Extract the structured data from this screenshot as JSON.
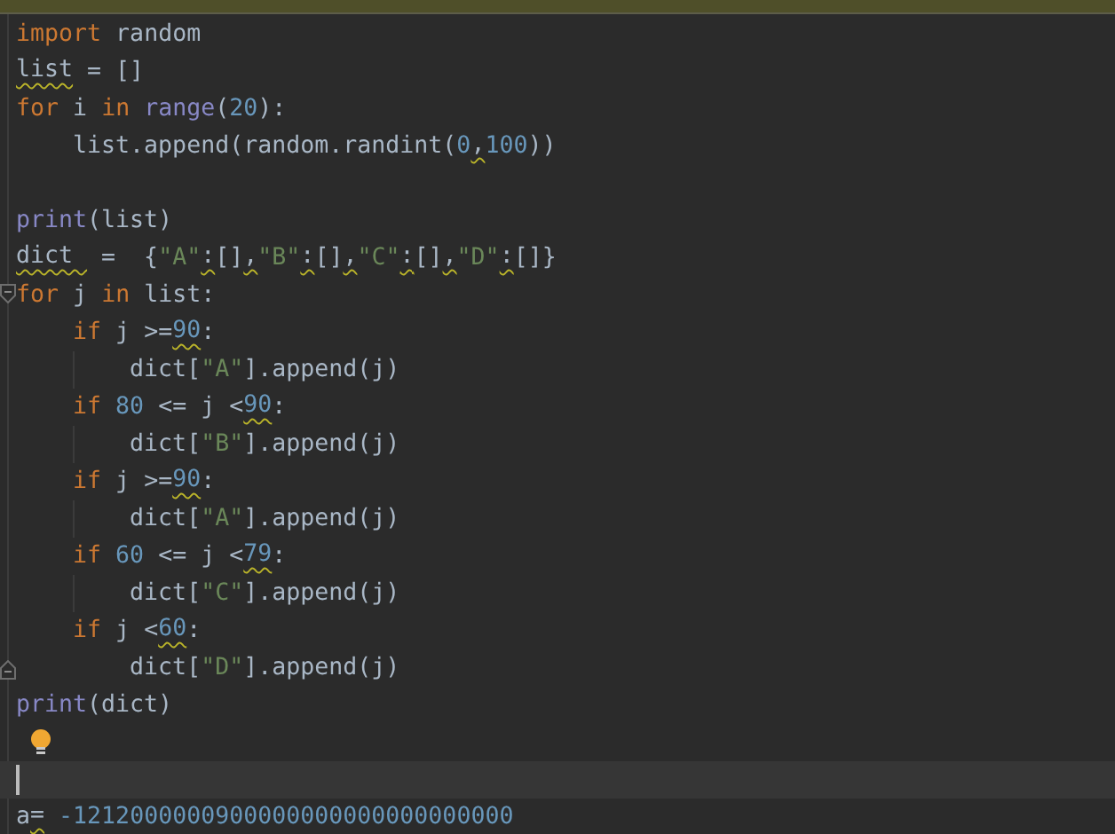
{
  "editor": {
    "lines": [
      {
        "kind": "plain",
        "current": false,
        "bulb": false,
        "tokens": [
          {
            "text": "import",
            "kind": "keyword",
            "warning": false
          },
          {
            "text": " random",
            "kind": "plain",
            "warning": false
          }
        ]
      },
      {
        "kind": "plain",
        "current": false,
        "bulb": false,
        "tokens": [
          {
            "text": "list",
            "kind": "plain",
            "warning": true
          },
          {
            "text": " = []",
            "kind": "plain",
            "warning": false
          }
        ]
      },
      {
        "kind": "plain",
        "current": false,
        "bulb": false,
        "tokens": [
          {
            "text": "for",
            "kind": "keyword",
            "warning": false
          },
          {
            "text": " i ",
            "kind": "plain",
            "warning": false
          },
          {
            "text": "in",
            "kind": "keyword",
            "warning": false
          },
          {
            "text": " range",
            "kind": "builtin",
            "warning": false
          },
          {
            "text": "(",
            "kind": "plain",
            "warning": false
          },
          {
            "text": "20",
            "kind": "number",
            "warning": false
          },
          {
            "text": "):",
            "kind": "plain",
            "warning": false
          }
        ]
      },
      {
        "kind": "plain",
        "current": false,
        "bulb": false,
        "tokens": [
          {
            "text": "    list.append(random.randint(",
            "kind": "plain",
            "warning": false
          },
          {
            "text": "0",
            "kind": "number",
            "warning": false
          },
          {
            "text": ",",
            "kind": "plain",
            "warning": true
          },
          {
            "text": "100",
            "kind": "number",
            "warning": false
          },
          {
            "text": "))",
            "kind": "plain",
            "warning": false
          }
        ]
      },
      {
        "kind": "plain",
        "current": false,
        "bulb": false
      },
      {
        "kind": "plain",
        "current": false,
        "bulb": false,
        "tokens": [
          {
            "text": "print",
            "kind": "builtin",
            "warning": false
          },
          {
            "text": "(list)",
            "kind": "plain",
            "warning": false
          }
        ]
      },
      {
        "kind": "plain",
        "current": false,
        "bulb": false,
        "tokens": [
          {
            "text": "dict ",
            "kind": "plain",
            "warning": true
          },
          {
            "text": " =  {",
            "kind": "plain",
            "warning": false
          },
          {
            "text": "\"A\"",
            "kind": "string",
            "warning": false
          },
          {
            "text": ":",
            "kind": "plain",
            "warning": true
          },
          {
            "text": "[]",
            "kind": "plain",
            "warning": false
          },
          {
            "text": ",",
            "kind": "plain",
            "warning": true
          },
          {
            "text": "\"B\"",
            "kind": "string",
            "warning": false
          },
          {
            "text": ":",
            "kind": "plain",
            "warning": true
          },
          {
            "text": "[]",
            "kind": "plain",
            "warning": false
          },
          {
            "text": ",",
            "kind": "plain",
            "warning": true
          },
          {
            "text": "\"C\"",
            "kind": "string",
            "warning": false
          },
          {
            "text": ":",
            "kind": "plain",
            "warning": true
          },
          {
            "text": "[]",
            "kind": "plain",
            "warning": false
          },
          {
            "text": ",",
            "kind": "plain",
            "warning": true
          },
          {
            "text": "\"D\"",
            "kind": "string",
            "warning": false
          },
          {
            "text": ":",
            "kind": "plain",
            "warning": true
          },
          {
            "text": "[]}",
            "kind": "plain",
            "warning": false
          }
        ]
      },
      {
        "kind": "opening",
        "current": false,
        "bulb": false,
        "tokens": [
          {
            "text": "for",
            "kind": "keyword",
            "warning": false
          },
          {
            "text": " j ",
            "kind": "plain",
            "warning": false
          },
          {
            "text": "in",
            "kind": "keyword",
            "warning": false
          },
          {
            "text": " list:",
            "kind": "plain",
            "warning": false
          }
        ]
      },
      {
        "kind": "plain",
        "current": false,
        "bulb": false,
        "tokens": [
          {
            "text": "    if",
            "kind": "keyword",
            "warning": false
          },
          {
            "text": " j >=",
            "kind": "plain",
            "warning": false
          },
          {
            "text": "90",
            "kind": "number",
            "warning": true
          },
          {
            "text": ":",
            "kind": "plain",
            "warning": false
          }
        ]
      },
      {
        "kind": "guided",
        "current": false,
        "bulb": false,
        "tokens": [
          {
            "text": "        dict[",
            "kind": "plain",
            "warning": false
          },
          {
            "text": "\"A\"",
            "kind": "string",
            "warning": false
          },
          {
            "text": "].append(j)",
            "kind": "plain",
            "warning": false
          }
        ]
      },
      {
        "kind": "plain",
        "current": false,
        "bulb": false,
        "tokens": [
          {
            "text": "    if",
            "kind": "keyword",
            "warning": false
          },
          {
            "text": " 80",
            "kind": "number",
            "warning": false
          },
          {
            "text": " <= j <",
            "kind": "plain",
            "warning": false
          },
          {
            "text": "90",
            "kind": "number",
            "warning": true
          },
          {
            "text": ":",
            "kind": "plain",
            "warning": false
          }
        ]
      },
      {
        "kind": "guided",
        "current": false,
        "bulb": false,
        "tokens": [
          {
            "text": "        dict[",
            "kind": "plain",
            "warning": false
          },
          {
            "text": "\"B\"",
            "kind": "string",
            "warning": false
          },
          {
            "text": "].append(j)",
            "kind": "plain",
            "warning": false
          }
        ]
      },
      {
        "kind": "plain",
        "current": false,
        "bulb": false,
        "tokens": [
          {
            "text": "    if",
            "kind": "keyword",
            "warning": false
          },
          {
            "text": " j >=",
            "kind": "plain",
            "warning": false
          },
          {
            "text": "90",
            "kind": "number",
            "warning": true
          },
          {
            "text": ":",
            "kind": "plain",
            "warning": false
          }
        ]
      },
      {
        "kind": "guided",
        "current": false,
        "bulb": false,
        "tokens": [
          {
            "text": "        dict[",
            "kind": "plain",
            "warning": false
          },
          {
            "text": "\"A\"",
            "kind": "string",
            "warning": false
          },
          {
            "text": "].append(j)",
            "kind": "plain",
            "warning": false
          }
        ]
      },
      {
        "kind": "plain",
        "current": false,
        "bulb": false,
        "tokens": [
          {
            "text": "    if",
            "kind": "keyword",
            "warning": false
          },
          {
            "text": " 60",
            "kind": "number",
            "warning": false
          },
          {
            "text": " <= j <",
            "kind": "plain",
            "warning": false
          },
          {
            "text": "79",
            "kind": "number",
            "warning": true
          },
          {
            "text": ":",
            "kind": "plain",
            "warning": false
          }
        ]
      },
      {
        "kind": "guided",
        "current": false,
        "bulb": false,
        "tokens": [
          {
            "text": "        dict[",
            "kind": "plain",
            "warning": false
          },
          {
            "text": "\"C\"",
            "kind": "string",
            "warning": false
          },
          {
            "text": "].append(j)",
            "kind": "plain",
            "warning": false
          }
        ]
      },
      {
        "kind": "plain",
        "current": false,
        "bulb": false,
        "tokens": [
          {
            "text": "    if",
            "kind": "keyword",
            "warning": false
          },
          {
            "text": " j <",
            "kind": "plain",
            "warning": false
          },
          {
            "text": "60",
            "kind": "number",
            "warning": true
          },
          {
            "text": ":",
            "kind": "plain",
            "warning": false
          }
        ]
      },
      {
        "kind": "closing",
        "current": false,
        "bulb": false,
        "tokens": [
          {
            "text": "        dict[",
            "kind": "plain",
            "warning": false
          },
          {
            "text": "\"D\"",
            "kind": "string",
            "warning": false
          },
          {
            "text": "].append(j)",
            "kind": "plain",
            "warning": false
          }
        ]
      },
      {
        "kind": "plain",
        "current": false,
        "bulb": false,
        "tokens": [
          {
            "text": "print",
            "kind": "builtin",
            "warning": false
          },
          {
            "text": "(dict)",
            "kind": "plain",
            "warning": false
          }
        ]
      },
      {
        "kind": "plain",
        "current": false,
        "bulb": true
      },
      {
        "kind": "plain",
        "current": true,
        "bulb": false
      },
      {
        "kind": "plain",
        "current": false,
        "bulb": false,
        "tokens": [
          {
            "text": "a",
            "kind": "plain",
            "warning": false
          },
          {
            "text": "=",
            "kind": "plain",
            "warning": true
          },
          {
            "text": " -1212000000900000000000000000000",
            "kind": "number",
            "warning": false
          }
        ]
      }
    ]
  }
}
